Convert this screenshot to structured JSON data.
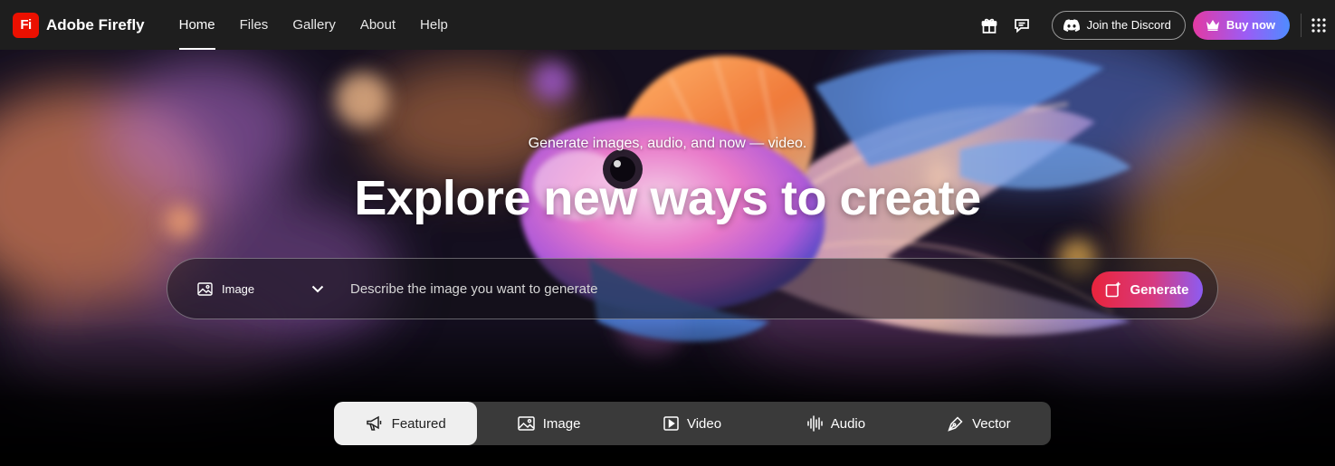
{
  "brand": {
    "logo_text": "Fi",
    "name": "Adobe Firefly"
  },
  "nav": {
    "items": [
      {
        "label": "Home",
        "active": true
      },
      {
        "label": "Files",
        "active": false
      },
      {
        "label": "Gallery",
        "active": false
      },
      {
        "label": "About",
        "active": false
      },
      {
        "label": "Help",
        "active": false
      }
    ]
  },
  "header_actions": {
    "gift_icon": "gift-icon",
    "feedback_icon": "chat-bubble-icon",
    "discord_label": "Join the Discord",
    "buy_label": "Buy now",
    "apps_icon": "apps-grid-icon"
  },
  "hero": {
    "subtitle": "Generate images, audio, and now — video.",
    "title": "Explore new ways to create"
  },
  "prompt": {
    "type_selected": "Image",
    "placeholder": "Describe the image you want to generate",
    "value": "",
    "generate_label": "Generate"
  },
  "categories": [
    {
      "label": "Featured",
      "icon": "megaphone-icon",
      "active": true
    },
    {
      "label": "Image",
      "icon": "image-icon",
      "active": false
    },
    {
      "label": "Video",
      "icon": "video-icon",
      "active": false
    },
    {
      "label": "Audio",
      "icon": "audio-wave-icon",
      "active": false
    },
    {
      "label": "Vector",
      "icon": "pen-nib-icon",
      "active": false
    }
  ],
  "colors": {
    "brand_red": "#eb1000",
    "topbar_bg": "#1e1e1e",
    "generate_start": "#e8243c",
    "generate_end": "#8c5cf2",
    "buy_start": "#e33aa3",
    "buy_end": "#4f8cff"
  }
}
